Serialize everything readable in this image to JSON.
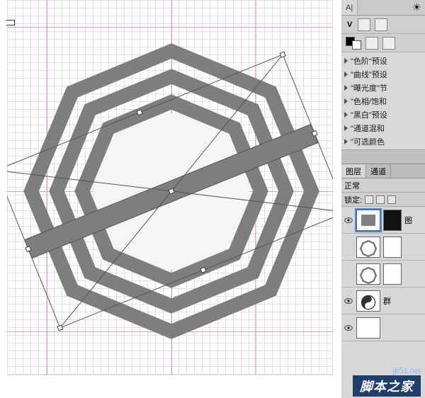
{
  "canvas": {
    "guides_h": [
      38,
      270,
      468
    ],
    "guides_v": [
      56,
      232,
      350
    ]
  },
  "toolbar": {
    "tab_a": "A|",
    "tab_v": "V"
  },
  "adjustments": {
    "items": [
      {
        "label": "\"色阶\"预设"
      },
      {
        "label": "\"曲线\"预设"
      },
      {
        "label": "\"曝光度\"节"
      },
      {
        "label": "\"色相/饱和"
      },
      {
        "label": "\"黑白\"预设"
      },
      {
        "label": "\"通道混和"
      },
      {
        "label": "\"可选颜色"
      }
    ]
  },
  "layers_panel": {
    "tabs": [
      "图层",
      "通道"
    ],
    "blend_mode": "正常",
    "lock_label": "锁定:",
    "rows": [
      {
        "type": "fill-gray",
        "selected": true,
        "name": "图"
      },
      {
        "type": "oct-white",
        "name": ""
      },
      {
        "type": "oct-white",
        "name": ""
      },
      {
        "type": "taiji",
        "name": "群"
      },
      {
        "type": "bg",
        "name": ""
      }
    ]
  },
  "watermark": {
    "url": "jb51.net",
    "text": "脚本之家"
  }
}
